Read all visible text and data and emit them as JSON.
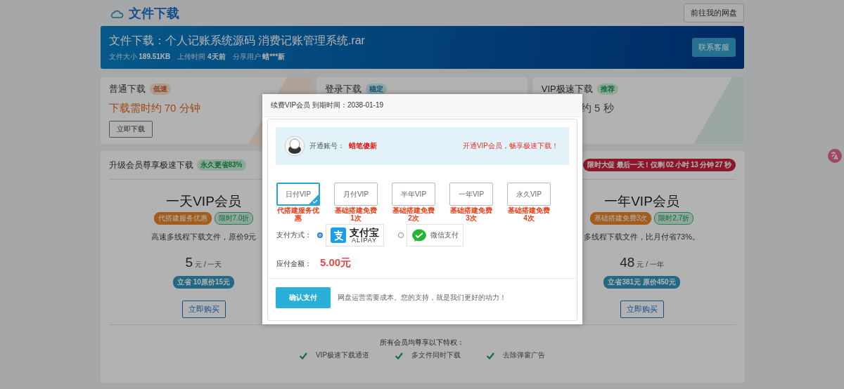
{
  "header": {
    "title": "文件下载",
    "button": "前往我的网盘"
  },
  "banner": {
    "title": "文件下载：个人记账系统源码 消费记账管理系统.rar",
    "meta": [
      {
        "label": "文件大小",
        "value": "189.51KB"
      },
      {
        "label": "上传时间",
        "value": "4天前"
      },
      {
        "label": "分享用户",
        "value": "蜡***新"
      }
    ],
    "button": "联系客服"
  },
  "download_cards": [
    {
      "title": "普通下载",
      "badge": "低速",
      "kind": "slow",
      "line": "下载需时约 70 分钟",
      "button": "立即下载"
    },
    {
      "title": "登录下载",
      "badge": "稳定",
      "kind": "stable"
    },
    {
      "title": "VIP极速下载",
      "badge": "推荐",
      "kind": "recommended",
      "line": "约 5 秒"
    }
  ],
  "upgrade": {
    "title": "升级会员尊享极速下载",
    "badge": "永久更省83%",
    "promo": "限时大促 最后一天！仅剩 02 小时 13 分钟 27 秒",
    "plans": [
      {
        "name": "一天VIP会员",
        "tags": [
          {
            "text": "代搭建服务优惠",
            "kind": "bonus"
          },
          {
            "text": "限时7.0折",
            "kind": "discount"
          }
        ],
        "desc": "高速多线程下载文件，原价9元",
        "price": "5",
        "unit": "元 / 一天",
        "save": "立省 10原价15元",
        "button": "立即购买"
      },
      {
        "name": "一年VIP会员",
        "tags": [
          {
            "text": "基础搭建免费3次",
            "kind": "bonus"
          },
          {
            "text": "限时2.7折",
            "kind": "discount"
          }
        ],
        "desc": "多线程下载文件，比月付省73%。",
        "price": "48",
        "unit": "元 / 一年",
        "save": "立省381元 原价450元",
        "button": "立即购买"
      }
    ],
    "perks_title": "所有会员均尊享以下特权：",
    "perks": [
      "VIP极速下载通道",
      "多文件同时下载",
      "去除弹窗广告"
    ]
  },
  "modal": {
    "title": "续费VIP会员 到期时间：2038-01-19",
    "account_label": "开通账号：",
    "account_name": "蜡笔傻新",
    "slogan": "开通VIP会员，畅享极速下载！",
    "options": [
      {
        "label": "日付VIP",
        "note": "代搭建服务优惠",
        "selected": true
      },
      {
        "label": "月付VIP",
        "note": "基础搭建免费1次",
        "selected": false
      },
      {
        "label": "半年VIP",
        "note": "基础搭建免费2次",
        "selected": false
      },
      {
        "label": "一年VIP",
        "note": "基础搭建免费3次",
        "selected": false
      },
      {
        "label": "永久VIP",
        "note": "基础搭建免费4次",
        "selected": false
      }
    ],
    "payment_label": "支付方式：",
    "payments": [
      {
        "kind": "alipay",
        "name": "支付宝",
        "subname": "ALIPAY",
        "selected": true
      },
      {
        "kind": "wechat",
        "name": "微信支付",
        "selected": false
      }
    ],
    "amount_label": "应付金额：",
    "amount": "5.00元",
    "confirm": "确认支付",
    "note": "网盘运营需要成本。您的支持，就是我们更好的动力！"
  }
}
